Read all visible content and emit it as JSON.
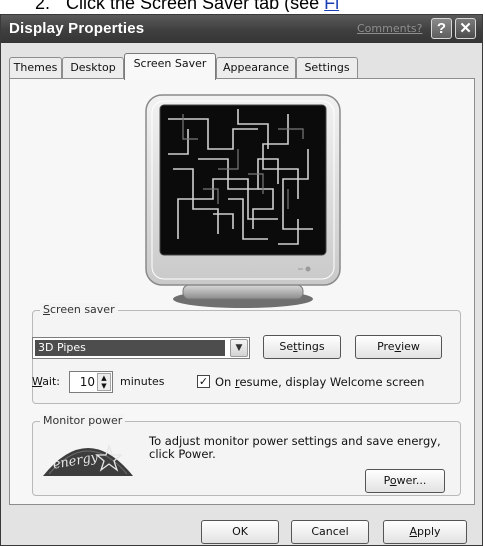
{
  "instruction": {
    "number": "2.",
    "text": "Click the Screen Saver tab (see ",
    "link": "Fi"
  },
  "window": {
    "title": "Display Properties",
    "comments_link": "Comments?",
    "help_glyph": "?",
    "close_glyph": "✕"
  },
  "tabs": [
    {
      "label": "Themes"
    },
    {
      "label": "Desktop"
    },
    {
      "label": "Screen Saver"
    },
    {
      "label": "Appearance"
    },
    {
      "label": "Settings"
    }
  ],
  "active_tab": "Screen Saver",
  "screen_saver": {
    "group_label_prefix": "S",
    "group_label_rest": "creen saver",
    "selected": "3D Pipes",
    "settings_prefix": "Se",
    "settings_mnemonic": "t",
    "settings_rest": "tings",
    "preview_prefix": "Pre",
    "preview_mnemonic": "v",
    "preview_rest": "iew",
    "wait_mnemonic": "W",
    "wait_rest": "ait:",
    "wait_value": "10",
    "minutes_label": "minutes",
    "resume_checked": true,
    "resume_prefix": "On ",
    "resume_mnemonic": "r",
    "resume_rest": "esume, display Welcome screen"
  },
  "monitor_power": {
    "group_label": "Monitor power",
    "description": "To adjust monitor power settings and save energy, click Power.",
    "power_mnemonic": "o",
    "power_prefix": "P",
    "power_rest": "wer..."
  },
  "buttons": {
    "ok": "OK",
    "cancel": "Cancel",
    "apply_mnemonic": "A",
    "apply_rest": "pply"
  }
}
